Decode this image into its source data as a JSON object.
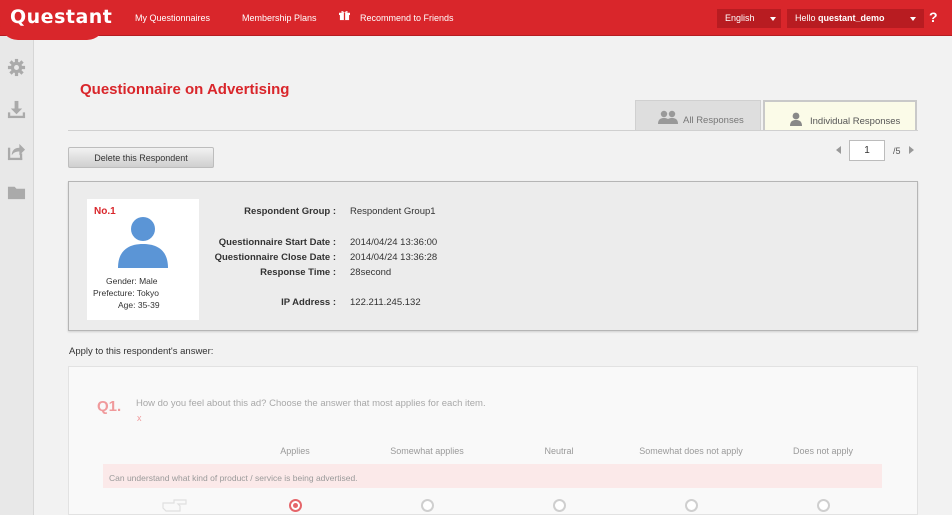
{
  "header": {
    "logo": "Questant",
    "nav": [
      "My Questionnaires",
      "Membership Plans",
      "Recommend to Friends"
    ],
    "language": "English",
    "greeting_prefix": "Hello",
    "username": "questant_demo",
    "help": "?"
  },
  "sidebar": {
    "icons": [
      "gear-icon",
      "download-icon",
      "share-icon",
      "folder-icon"
    ]
  },
  "page": {
    "title": "Questionnaire on Advertising",
    "tabs": [
      {
        "label": "All Responses",
        "icon": "group-icon",
        "active": false
      },
      {
        "label": "Individual Responses",
        "icon": "person-icon",
        "active": true
      }
    ],
    "delete_button": "Delete this Respondent",
    "pager": {
      "current": "1",
      "total": "/5"
    }
  },
  "respondent": {
    "number": "No.1",
    "gender": "Gender: Male",
    "prefecture": "Prefecture: Tokyo",
    "age": "Age: 35-39",
    "fields": [
      {
        "label": "Respondent Group :",
        "value": "Respondent Group1"
      },
      {
        "label": "Questionnaire Start Date :",
        "value": "2014/04/24 13:36:00"
      },
      {
        "label": "Questionnaire Close Date :",
        "value": "2014/04/24 13:36:28"
      },
      {
        "label": "Response Time :",
        "value": "28second"
      },
      {
        "label": "IP Address :",
        "value": "122.211.245.132"
      }
    ]
  },
  "apply_text": "Apply to this respondent's answer:",
  "question": {
    "number": "Q1.",
    "text": "How do you feel about this ad?  Choose the answer that most applies for each item.",
    "required_mark": "x",
    "columns": [
      "Applies",
      "Somewhat applies",
      "Neutral",
      "Somewhat does not apply",
      "Does not apply"
    ],
    "rows": [
      {
        "label": "Can understand what kind of product / service is being advertised.",
        "selected": 0
      }
    ]
  },
  "colors": {
    "brand": "#d9262b",
    "tab_active": "#fbfbe8",
    "row_band": "#fbe9e9"
  }
}
